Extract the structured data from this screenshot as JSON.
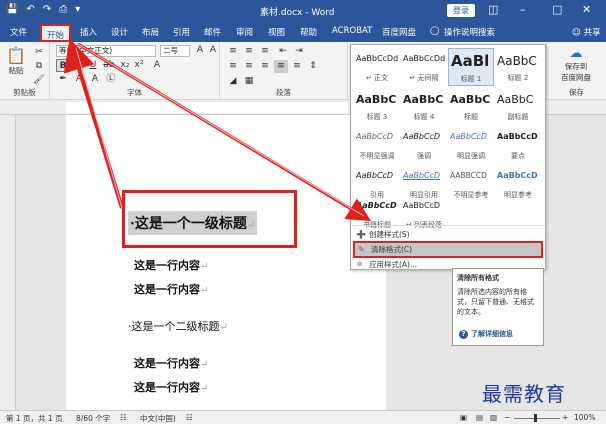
{
  "window": {
    "title": "素材.docx - Word",
    "login_label": "登录",
    "min_icon": "minimize-icon",
    "max_icon": "restore-icon",
    "close_icon": "close-icon"
  },
  "tabs": [
    {
      "label": "文件"
    },
    {
      "label": "开始"
    },
    {
      "label": "插入"
    },
    {
      "label": "设计"
    },
    {
      "label": "布局"
    },
    {
      "label": "引用"
    },
    {
      "label": "邮件"
    },
    {
      "label": "审阅"
    },
    {
      "label": "视图"
    },
    {
      "label": "帮助"
    },
    {
      "label": "ACROBAT"
    },
    {
      "label": "百度网盘"
    },
    {
      "label": "操作说明搜索"
    }
  ],
  "share_label": "共享",
  "ribbon": {
    "clipboard": {
      "label": "剪贴板",
      "paste": "粘贴"
    },
    "font": {
      "label": "字体",
      "font_name": "等线 (中文正文)",
      "font_size": "二号"
    },
    "paragraph": {
      "label": "段落"
    },
    "baidu": {
      "label": "保存",
      "save_to": "保存到",
      "baidu_pan": "百度网盘"
    }
  },
  "styles": [
    {
      "sample": "AaBbCcDd",
      "name": "正文"
    },
    {
      "sample": "AaBbCcDd",
      "name": "无间隔"
    },
    {
      "sample": "AaBl",
      "name": "标题 1"
    },
    {
      "sample": "AaBbC",
      "name": "标题 2"
    },
    {
      "sample": "AaBbC",
      "name": "标题 3"
    },
    {
      "sample": "AaBbC",
      "name": "标题 4"
    },
    {
      "sample": "AaBbC",
      "name": "标题"
    },
    {
      "sample": "AaBbC",
      "name": "副标题"
    },
    {
      "sample": "AaBbCcD",
      "name": "不明显强调"
    },
    {
      "sample": "AaBbCcD",
      "name": "强调"
    },
    {
      "sample": "AaBbCcD",
      "name": "明显强调"
    },
    {
      "sample": "AaBbCcD",
      "name": "要点"
    },
    {
      "sample": "AaBbCcD",
      "name": "引用"
    },
    {
      "sample": "AaBbCcD",
      "name": "明显引用"
    },
    {
      "sample": "AABBCCD",
      "name": "不明显参考"
    },
    {
      "sample": "AaBbCcD",
      "name": "明显参考"
    },
    {
      "sample": "AaBbCcD",
      "name": "书籍标题"
    },
    {
      "sample": "AaBbCcD",
      "name": "列表段落"
    }
  ],
  "menu": {
    "create": "创建样式(S)",
    "clear": "清除格式(C)",
    "apply": "应用样式(A)..."
  },
  "tooltip": {
    "title": "清除所有格式",
    "body": "清除所选内容的所有格式，只留下普通、无格式的文本。",
    "link": "了解详细信息"
  },
  "document": {
    "heading1": "这是一个一级标题",
    "line1": "这是一行内容",
    "line2": "这是一行内容",
    "heading2": "这是一个二级标题",
    "line3": "这是一行内容",
    "line4": "这是一行内容",
    "para_mark": "↵"
  },
  "status": {
    "page": "第 1 页，共 1 页",
    "words": "8/60 个字",
    "lang": "中文(中国)",
    "zoom": "100%"
  },
  "watermark": "最需教育",
  "colors": {
    "accent": "#2b579a",
    "highlight": "#e0201d"
  }
}
